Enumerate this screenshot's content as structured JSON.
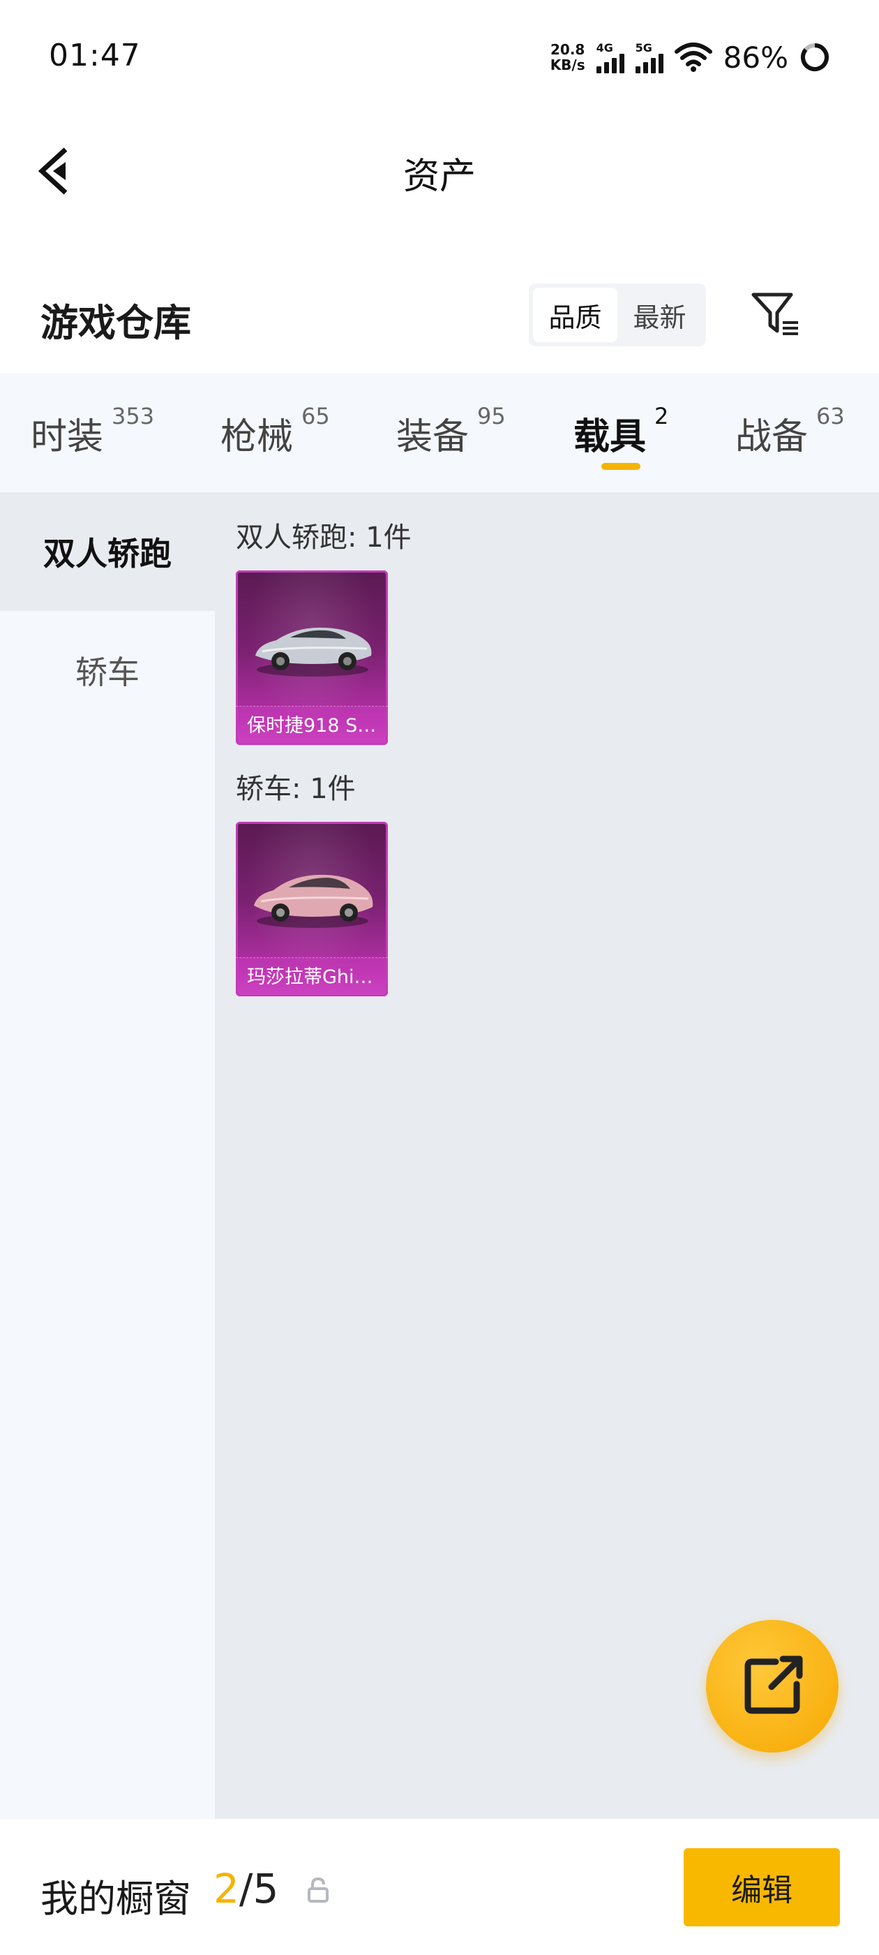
{
  "status_bar": {
    "time": "01:47",
    "net_speed_value": "20.8",
    "net_speed_unit": "KB/s",
    "signal_4g_label": "4G",
    "signal_5g_label": "5G",
    "battery_percent": "86%"
  },
  "header": {
    "title": "资产"
  },
  "warehouse": {
    "title": "游戏仓库",
    "sort_options": [
      "品质",
      "最新"
    ],
    "selected_sort": "品质"
  },
  "category_tabs": [
    {
      "name": "时装",
      "count": "353"
    },
    {
      "name": "枪械",
      "count": "65"
    },
    {
      "name": "装备",
      "count": "95"
    },
    {
      "name": "载具",
      "count": "2"
    },
    {
      "name": "战备",
      "count": "63"
    }
  ],
  "active_category": "载具",
  "sidebar": {
    "items": [
      "双人轿跑",
      "轿车"
    ],
    "active": "双人轿跑"
  },
  "groups": [
    {
      "title": "双人轿跑: 1件",
      "items": [
        {
          "name": "保时捷918 S…",
          "car_color": "#c8ccd4"
        }
      ]
    },
    {
      "title": "轿车: 1件",
      "items": [
        {
          "name": "玛莎拉蒂Ghi…",
          "car_color": "#e0a9b2"
        }
      ]
    }
  ],
  "bottom_bar": {
    "title": "我的橱窗",
    "current": "2",
    "separator": "/",
    "total": "5",
    "edit_label": "编辑"
  },
  "colors": {
    "accent": "#f4b400",
    "card_purple": "#b530a8"
  }
}
